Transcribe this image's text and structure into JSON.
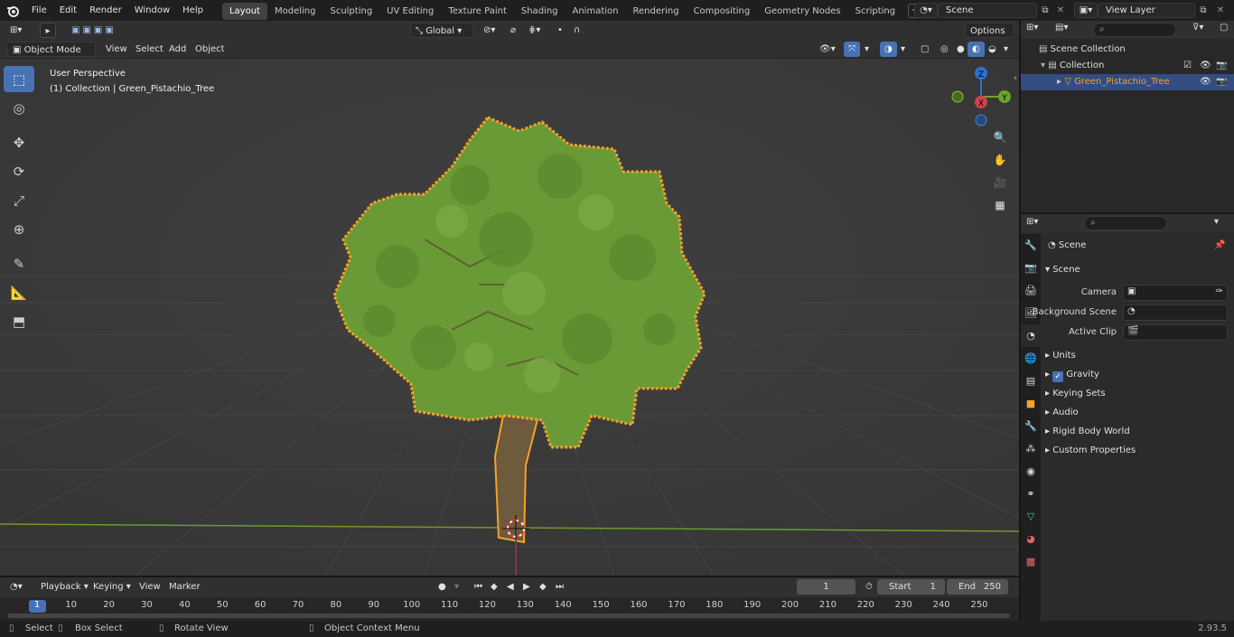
{
  "app": {
    "version": "2.93.5"
  },
  "menu": [
    "File",
    "Edit",
    "Render",
    "Window",
    "Help"
  ],
  "workspaces": [
    {
      "label": "Layout",
      "active": true
    },
    {
      "label": "Modeling"
    },
    {
      "label": "Sculpting"
    },
    {
      "label": "UV Editing"
    },
    {
      "label": "Texture Paint"
    },
    {
      "label": "Shading"
    },
    {
      "label": "Animation"
    },
    {
      "label": "Rendering"
    },
    {
      "label": "Compositing"
    },
    {
      "label": "Geometry Nodes"
    },
    {
      "label": "Scripting"
    }
  ],
  "scene_selector": {
    "value": "Scene"
  },
  "viewlayer_selector": {
    "value": "View Layer"
  },
  "viewport": {
    "mode": "Object Mode",
    "menus": [
      "View",
      "Select",
      "Add",
      "Object"
    ],
    "transform_orientation": "Global",
    "options_label": "Options",
    "overlay_title": "User Perspective",
    "overlay_sub": "(1) Collection | Green_Pistachio_Tree",
    "gizmo": {
      "z": "Z",
      "y": "Y",
      "x": "X"
    }
  },
  "outliner": {
    "rows": [
      {
        "label": "Scene Collection",
        "icon": "collection-icon"
      },
      {
        "label": "Collection",
        "icon": "collection-icon"
      },
      {
        "label": "Green_Pistachio_Tree",
        "icon": "mesh-icon",
        "selected": true
      }
    ]
  },
  "properties": {
    "breadcrumb": "Scene",
    "section": "Scene",
    "fields": [
      {
        "label": "Camera"
      },
      {
        "label": "Background Scene"
      },
      {
        "label": "Active Clip"
      }
    ],
    "panels": [
      "Units",
      "Gravity",
      "Keying Sets",
      "Audio",
      "Rigid Body World",
      "Custom Properties"
    ],
    "gravity_checked": true
  },
  "timeline": {
    "menus": [
      "Playback",
      "Keying",
      "View",
      "Marker"
    ],
    "current_frame": "1",
    "start_label": "Start",
    "start": "1",
    "end_label": "End",
    "end": "250",
    "ticks": [
      "1",
      "10",
      "20",
      "30",
      "40",
      "50",
      "60",
      "70",
      "80",
      "90",
      "100",
      "110",
      "120",
      "130",
      "140",
      "150",
      "160",
      "170",
      "180",
      "190",
      "200",
      "210",
      "220",
      "230",
      "240",
      "250"
    ]
  },
  "statusbar": {
    "items": [
      "Select",
      "Box Select",
      "Rotate View",
      "Object Context Menu"
    ]
  },
  "colors": {
    "accent": "#4772b3",
    "selection_outline": "#f5a12a",
    "foliage": "#6a9a36",
    "trunk": "#6e5a3c",
    "grid_x_axis": "#6d9a2a"
  }
}
